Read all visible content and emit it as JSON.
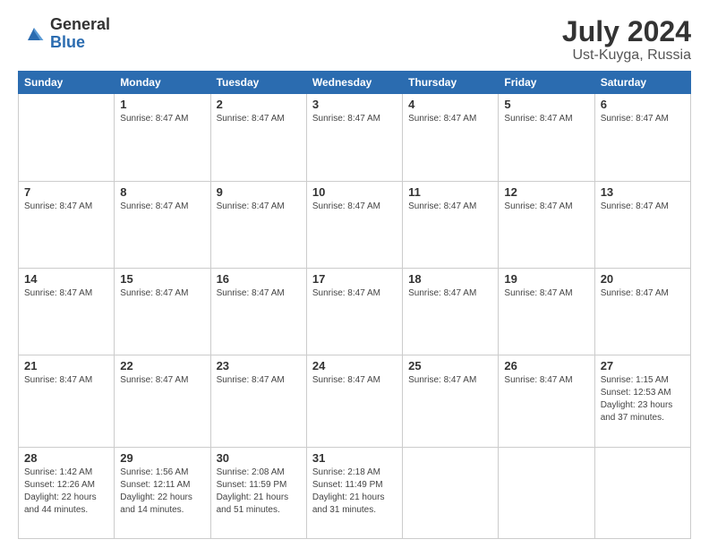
{
  "logo": {
    "general": "General",
    "blue": "Blue"
  },
  "header": {
    "title": "July 2024",
    "subtitle": "Ust-Kuyga, Russia"
  },
  "days_of_week": [
    "Sunday",
    "Monday",
    "Tuesday",
    "Wednesday",
    "Thursday",
    "Friday",
    "Saturday"
  ],
  "weeks": [
    [
      {
        "day": "",
        "info": ""
      },
      {
        "day": "1",
        "info": "Sunrise: 8:47 AM"
      },
      {
        "day": "2",
        "info": "Sunrise: 8:47 AM"
      },
      {
        "day": "3",
        "info": "Sunrise: 8:47 AM"
      },
      {
        "day": "4",
        "info": "Sunrise: 8:47 AM"
      },
      {
        "day": "5",
        "info": "Sunrise: 8:47 AM"
      },
      {
        "day": "6",
        "info": "Sunrise: 8:47 AM"
      }
    ],
    [
      {
        "day": "7",
        "info": "Sunrise: 8:47 AM"
      },
      {
        "day": "8",
        "info": "Sunrise: 8:47 AM"
      },
      {
        "day": "9",
        "info": "Sunrise: 8:47 AM"
      },
      {
        "day": "10",
        "info": "Sunrise: 8:47 AM"
      },
      {
        "day": "11",
        "info": "Sunrise: 8:47 AM"
      },
      {
        "day": "12",
        "info": "Sunrise: 8:47 AM"
      },
      {
        "day": "13",
        "info": "Sunrise: 8:47 AM"
      }
    ],
    [
      {
        "day": "14",
        "info": "Sunrise: 8:47 AM"
      },
      {
        "day": "15",
        "info": "Sunrise: 8:47 AM"
      },
      {
        "day": "16",
        "info": "Sunrise: 8:47 AM"
      },
      {
        "day": "17",
        "info": "Sunrise: 8:47 AM"
      },
      {
        "day": "18",
        "info": "Sunrise: 8:47 AM"
      },
      {
        "day": "19",
        "info": "Sunrise: 8:47 AM"
      },
      {
        "day": "20",
        "info": "Sunrise: 8:47 AM"
      }
    ],
    [
      {
        "day": "21",
        "info": "Sunrise: 8:47 AM"
      },
      {
        "day": "22",
        "info": "Sunrise: 8:47 AM"
      },
      {
        "day": "23",
        "info": "Sunrise: 8:47 AM"
      },
      {
        "day": "24",
        "info": "Sunrise: 8:47 AM"
      },
      {
        "day": "25",
        "info": "Sunrise: 8:47 AM"
      },
      {
        "day": "26",
        "info": "Sunrise: 8:47 AM"
      },
      {
        "day": "27",
        "info": "Sunrise: 1:15 AM\nSunset: 12:53 AM\nDaylight: 23 hours and 37 minutes."
      }
    ],
    [
      {
        "day": "28",
        "info": "Sunrise: 1:42 AM\nSunset: 12:26 AM\nDaylight: 22 hours and 44 minutes."
      },
      {
        "day": "29",
        "info": "Sunrise: 1:56 AM\nSunset: 12:11 AM\nDaylight: 22 hours and 14 minutes."
      },
      {
        "day": "30",
        "info": "Sunrise: 2:08 AM\nSunset: 11:59 PM\nDaylight: 21 hours and 51 minutes."
      },
      {
        "day": "31",
        "info": "Sunrise: 2:18 AM\nSunset: 11:49 PM\nDaylight: 21 hours and 31 minutes."
      },
      {
        "day": "",
        "info": ""
      },
      {
        "day": "",
        "info": ""
      },
      {
        "day": "",
        "info": ""
      }
    ]
  ]
}
